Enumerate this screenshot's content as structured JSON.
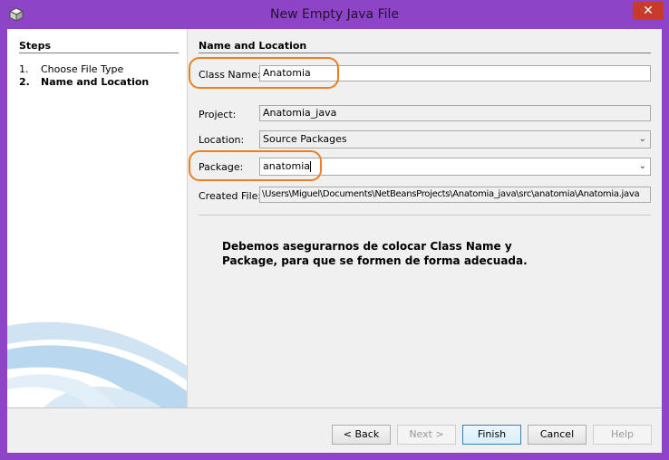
{
  "window": {
    "title": "New Empty Java File",
    "close_label": "✕"
  },
  "steps": {
    "title": "Steps",
    "items": [
      {
        "num": "1.",
        "label": "Choose File Type"
      },
      {
        "num": "2.",
        "label": "Name and Location"
      }
    ]
  },
  "form": {
    "section_title": "Name and Location",
    "class_name_label": "Class Name:",
    "class_name_value": "Anatomia",
    "project_label": "Project:",
    "project_value": "Anatomia_java",
    "location_label": "Location:",
    "location_value": "Source Packages",
    "package_label": "Package:",
    "package_value": "anatomia",
    "created_file_label": "Created File:",
    "created_file_value": "\\Users\\Miguel\\Documents\\NetBeansProjects\\Anatomia_java\\src\\anatomia\\Anatomia.java"
  },
  "note": "Debemos asegurarnos de colocar Class Name y Package, para que se formen de forma adecuada.",
  "buttons": {
    "back": "< Back",
    "next": "Next >",
    "finish": "Finish",
    "cancel": "Cancel",
    "help": "Help"
  },
  "colors": {
    "titlebar": "#8e44c6",
    "highlight": "#f07e21",
    "close": "#c73b2b"
  }
}
